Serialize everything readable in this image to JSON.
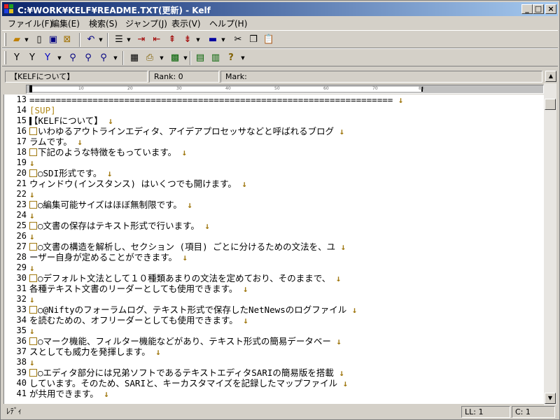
{
  "window": {
    "title": "C:¥WORK¥KELF¥README.TXT(更新)  - Kelf",
    "minimize": "_",
    "maximize": "□",
    "close": "×"
  },
  "menu": [
    "ファイル(F)",
    "編集(E)",
    "検索(S)",
    "ジャンプ(J)",
    "表示(V)",
    "ヘルプ(H)"
  ],
  "toolbar1_icons": [
    "open-icon",
    "new-icon",
    "save-icon",
    "close-file-icon",
    "undo-icon",
    "list-icon",
    "indent-icon",
    "outdent-icon",
    "move-up-icon",
    "move-down-icon",
    "color-icon",
    "cut-icon",
    "copy-icon",
    "paste-icon"
  ],
  "toolbar2_icons": [
    "filter-icon",
    "filter-next-icon",
    "filter-mark-icon",
    "find-icon",
    "replace-icon",
    "search-icon",
    "outline-icon",
    "print-icon",
    "chart-icon",
    "properties-icon",
    "book-icon",
    "help-icon"
  ],
  "infobar": {
    "section": "【KELFについて】",
    "rank": "Rank: 0",
    "mark": "Mark:"
  },
  "ruler": {
    "marks": [
      "10",
      "20",
      "30",
      "40",
      "50",
      "60",
      "70",
      "80"
    ]
  },
  "lines": [
    {
      "n": "13",
      "t": "=====================================================================",
      "r": true
    },
    {
      "n": "14",
      "t": "[SUP]",
      "sup": true,
      "r": false
    },
    {
      "n": "15",
      "t": "【KELFについて】",
      "r": true
    },
    {
      "n": "16",
      "t": "いわゆるアウトラインエディタ、アイデアプロセッサなどと呼ばれるブログ",
      "box": true,
      "r": true
    },
    {
      "n": "17",
      "t": "ラムです。",
      "r": true
    },
    {
      "n": "18",
      "t": "下記のような特徴をもっています。",
      "box": true,
      "r": true
    },
    {
      "n": "19",
      "t": "",
      "r": true
    },
    {
      "n": "20",
      "t": "○SDI形式です。",
      "box": true,
      "r": true
    },
    {
      "n": "21",
      "t": "      ウィンドウ(インスタンス) はいくつでも開けます。",
      "r": true
    },
    {
      "n": "22",
      "t": "",
      "r": true
    },
    {
      "n": "23",
      "t": "○編集可能サイズはほぼ無制限です。",
      "box": true,
      "r": true
    },
    {
      "n": "24",
      "t": "",
      "r": true
    },
    {
      "n": "25",
      "t": "○文書の保存はテキスト形式で行います。",
      "box": true,
      "r": true
    },
    {
      "n": "26",
      "t": "",
      "r": true
    },
    {
      "n": "27",
      "t": "○文書の構造を解析し、セクション (項目) ごとに分けるための文法を、ユ",
      "box": true,
      "r": true
    },
    {
      "n": "28",
      "t": "ーザー自身が定めることができます。",
      "r": true
    },
    {
      "n": "29",
      "t": "",
      "r": true
    },
    {
      "n": "30",
      "t": "○デフォルト文法として１０種類あまりの文法を定めており、そのままで、",
      "box": true,
      "r": true
    },
    {
      "n": "31",
      "t": "各種テキスト文書のリーダーとしても使用できます。",
      "r": true
    },
    {
      "n": "32",
      "t": "",
      "r": true
    },
    {
      "n": "33",
      "t": "○@Niftyのフォーラムログ、テキスト形式で保存したNetNewsのログファイル",
      "box": true,
      "r": true
    },
    {
      "n": "34",
      "t": "を読むための、オフリーダーとしても使用できます。",
      "r": true
    },
    {
      "n": "35",
      "t": "",
      "r": true
    },
    {
      "n": "36",
      "t": "○マーク機能、フィルター機能などがあり、テキスト形式の簡易データベー",
      "box": true,
      "r": true
    },
    {
      "n": "37",
      "t": "スとしても威力を発揮します。",
      "r": true
    },
    {
      "n": "38",
      "t": "",
      "r": true
    },
    {
      "n": "39",
      "t": "○エディタ部分には兄弟ソフトであるテキストエディタSARIの簡易版を搭載",
      "box": true,
      "r": true
    },
    {
      "n": "40",
      "t": "しています。そのため、SARIと、キーカスタマイズを記録したマップファイル",
      "r": true
    },
    {
      "n": "41",
      "t": "が共用できます。",
      "r": true
    }
  ],
  "return_mark": "↓",
  "status": {
    "mode": "ﾚﾃﾞｨ",
    "ll": "LL:   1",
    "col": "C:  1"
  },
  "colors": {
    "titlebar_start": "#0a246a",
    "titlebar_end": "#a6caf0",
    "return_mark": "#a07810",
    "face": "#d4d0c8"
  }
}
